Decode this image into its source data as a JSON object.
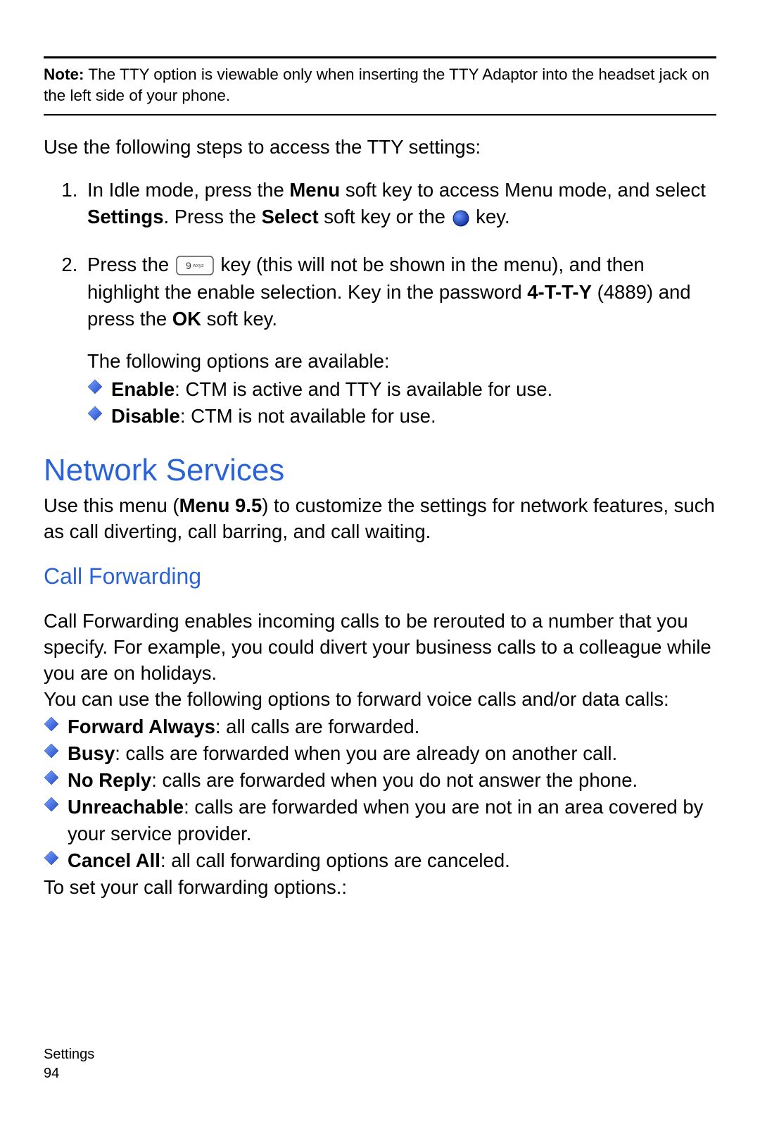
{
  "note": {
    "label": "Note:",
    "text": " The TTY option is viewable only when inserting the TTY Adaptor into the headset jack on the left side of your phone."
  },
  "intro": "Use the following steps to access the TTY settings:",
  "steps": {
    "s1": {
      "a": "In Idle mode, press the ",
      "menu": "Menu",
      "b": " soft key to access Menu mode, and select ",
      "settings": "Settings",
      "c": ". Press the ",
      "select": "Select",
      "d": " soft key or the ",
      "e": " key."
    },
    "s2": {
      "a": "Press the ",
      "b": " key (this will not be shown in the menu), and then highlight the enable selection. Key in the password ",
      "pw": "4-T-T-Y",
      "c": " (4889) and press the ",
      "ok": "OK",
      "d": " soft key.",
      "after": "The following options are available:"
    }
  },
  "ttyOptions": {
    "enable": {
      "label": "Enable",
      "desc": ": CTM is active and TTY is available for use."
    },
    "disable": {
      "label": "Disable",
      "desc": ": CTM is not available for use."
    }
  },
  "network": {
    "heading": "Network Services",
    "p_a": "Use this menu (",
    "menu95": "Menu 9.5",
    "p_b": ") to customize the settings for network features, such as call diverting, call barring, and call waiting."
  },
  "callfwd": {
    "heading": "Call Forwarding",
    "p1": "Call Forwarding enables incoming calls to be rerouted to a number that you specify. For example, you could divert your business calls to a colleague while you are on holidays.",
    "p2": "You can use the following options to forward voice calls and/or data calls:",
    "opts": {
      "always": {
        "label": "Forward Always",
        "desc": ": all calls are forwarded."
      },
      "busy": {
        "label": "Busy",
        "desc": ": calls are forwarded when you are already on another call."
      },
      "noreply": {
        "label": "No Reply",
        "desc": ": calls are forwarded when you do not answer the phone."
      },
      "unreach": {
        "label": "Unreachable",
        "desc": ": calls are forwarded when you are not in an area covered by your service provider."
      },
      "cancel": {
        "label": "Cancel All",
        "desc": ": all call forwarding options are canceled."
      }
    },
    "trailer": "To set your call forwarding options.:"
  },
  "footer": {
    "section": "Settings",
    "page": "94"
  }
}
